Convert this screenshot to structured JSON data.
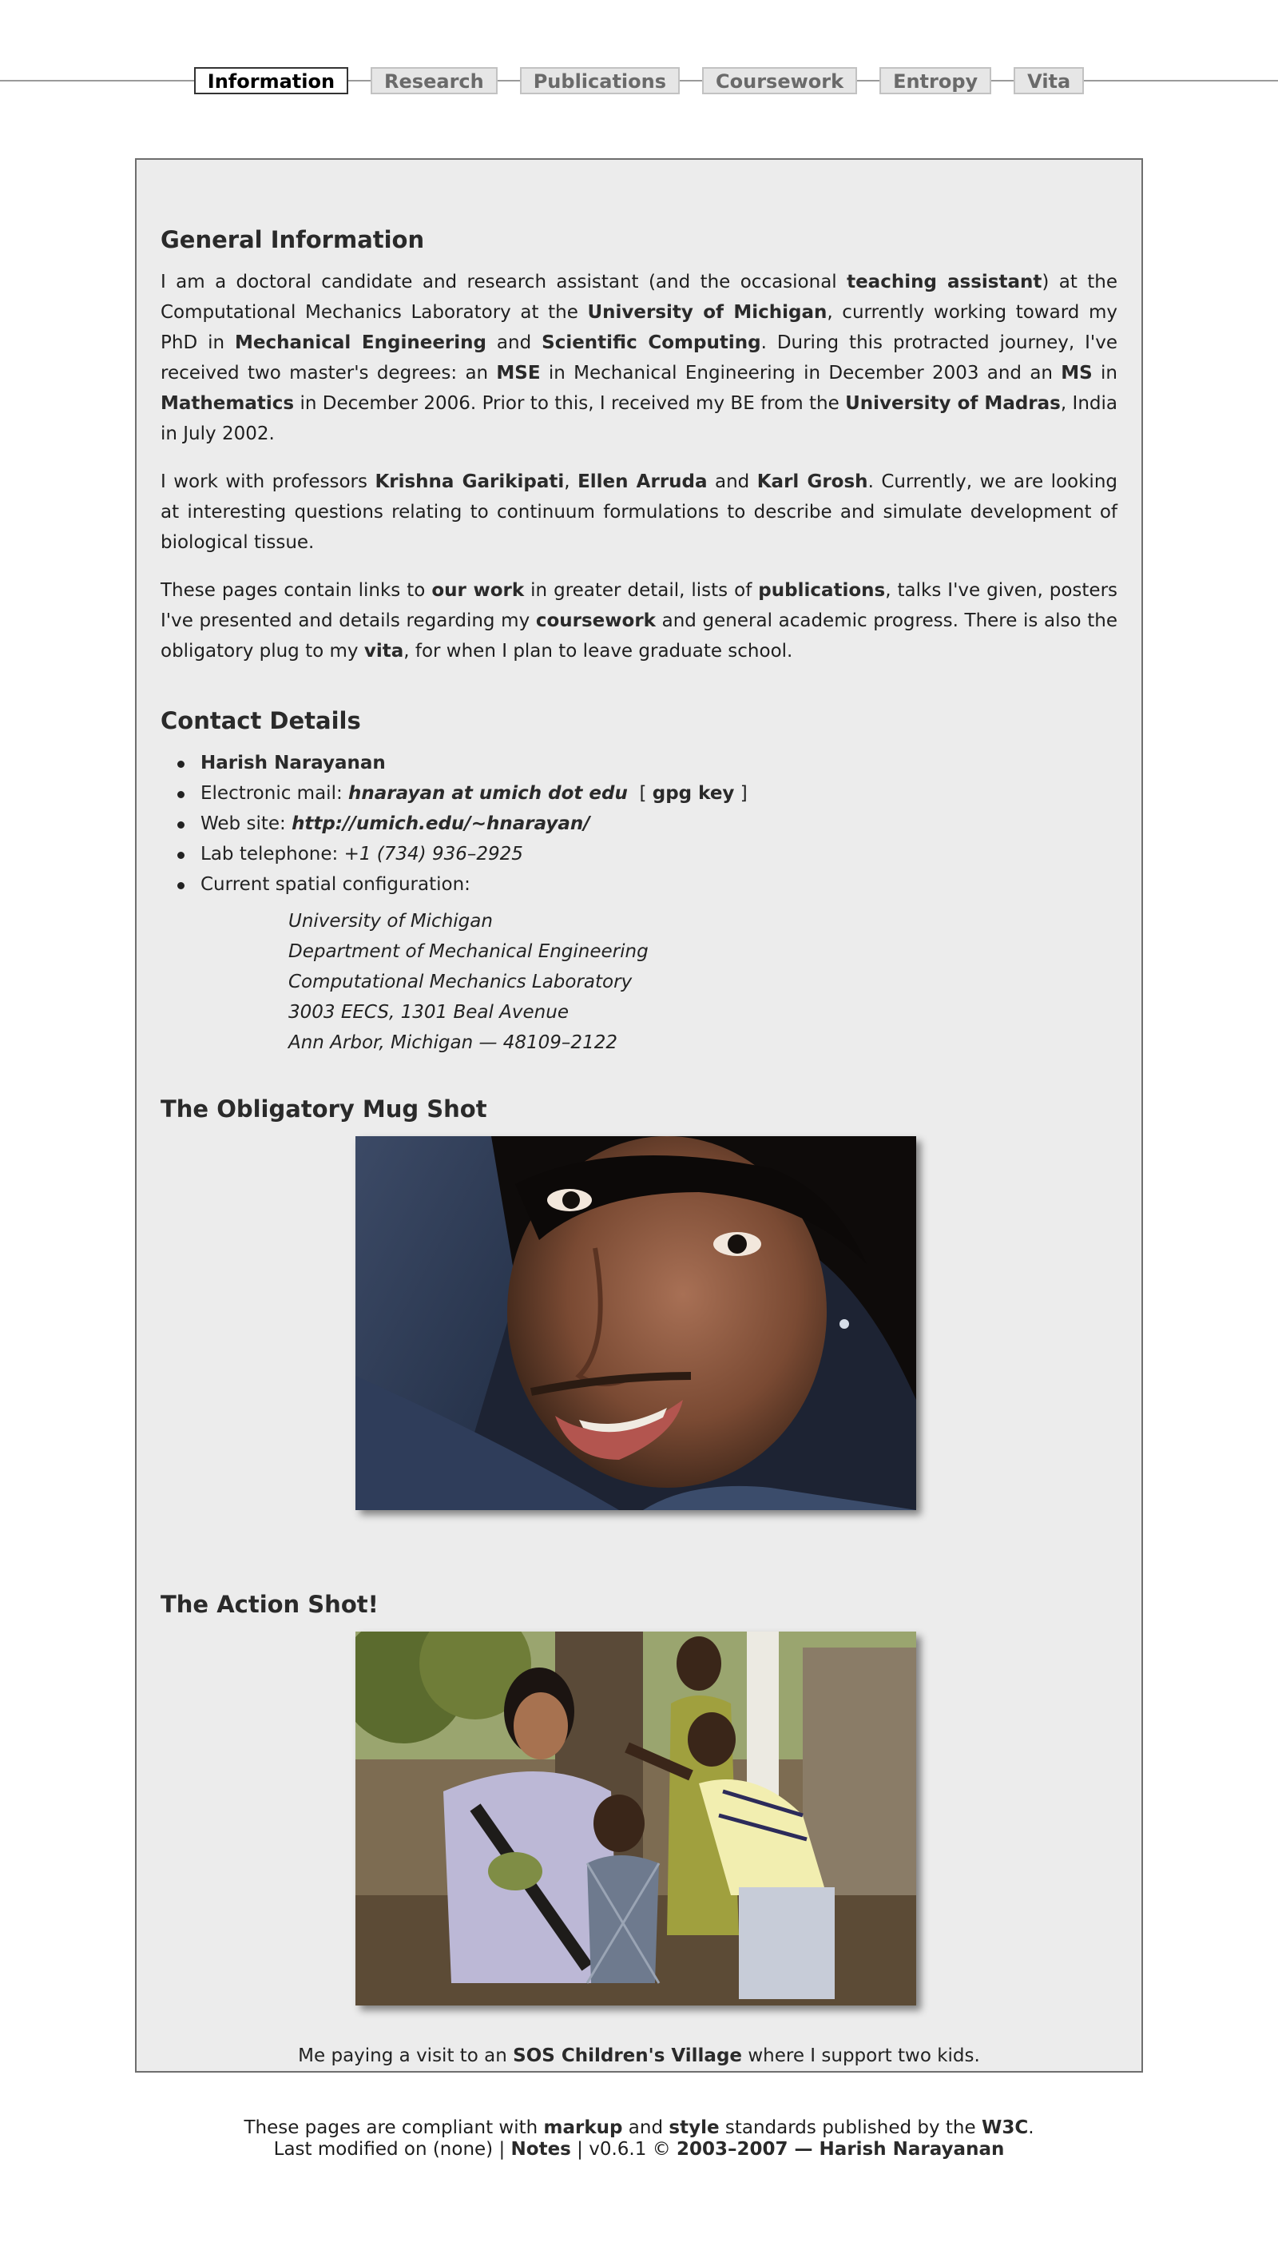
{
  "nav": {
    "items": [
      {
        "label": "Information",
        "active": true
      },
      {
        "label": "Research",
        "active": false
      },
      {
        "label": "Publications",
        "active": false
      },
      {
        "label": "Coursework",
        "active": false
      },
      {
        "label": "Entropy",
        "active": false
      },
      {
        "label": "Vita",
        "active": false
      }
    ]
  },
  "general": {
    "heading": "General Information",
    "p1": {
      "t1": "I am a doctoral candidate and research assistant (and the occasional ",
      "b1": "teaching assistant",
      "t2": ") at the Computational Mechanics Laboratory at the ",
      "b2": "University of Michigan",
      "t3": ", currently working toward my PhD in ",
      "b3": "Mechanical Engineering",
      "t4": " and ",
      "b4": "Scientific Computing",
      "t5": ". During this protracted journey, I've received two master's degrees: an ",
      "b5": "MSE",
      "t6": " in Mechanical Engineering in December 2003 and an ",
      "b6": "MS",
      "t7": " in ",
      "b7": "Mathematics",
      "t8": " in December 2006. Prior to this, I received my BE from the ",
      "b8": "University of Madras",
      "t9": ", India in July 2002."
    },
    "p2": {
      "t1": "I work with professors ",
      "b1": "Krishna Garikipati",
      "t2": ", ",
      "b2": "Ellen Arruda",
      "t3": " and ",
      "b3": "Karl Grosh",
      "t4": ". Currently, we are looking at interesting questions relating to continuum formulations to describe and simulate development of biological tissue."
    },
    "p3": {
      "t1": "These pages contain links to ",
      "b1": "our work",
      "t2": " in greater detail, lists of ",
      "b2": "publications",
      "t3": ", talks I've given, posters I've presented and details regarding my ",
      "b3": "coursework",
      "t4": " and general academic progress. There is also the obligatory plug to my ",
      "b4": "vita",
      "t5": ", for when I plan to leave graduate school."
    }
  },
  "contact": {
    "heading": "Contact Details",
    "name": "Harish Narayanan",
    "email_label": "Electronic mail: ",
    "email": "hnarayan at umich dot edu",
    "gpg_open": "[",
    "gpg": "gpg key",
    "gpg_close": "]",
    "web_label": "Web site: ",
    "web": "http://umich.edu/~hnarayan/",
    "phone_label": "Lab telephone: ",
    "phone": "+1 (734) 936–2925",
    "location_label": "Current spatial configuration:",
    "address": [
      "University of Michigan",
      "Department of Mechanical Engineering",
      "Computational Mechanics Laboratory",
      "3003 EECS, 1301 Beal Avenue",
      "Ann Arbor, Michigan — 48109–2122"
    ]
  },
  "mug": {
    "heading": "The Obligatory Mug Shot"
  },
  "action": {
    "heading": "The Action Shot!",
    "caption_t1": "Me paying a visit to an ",
    "caption_b1": "SOS Children's Village",
    "caption_t2": " where I support two kids."
  },
  "footer": {
    "l1_t1": "These pages are compliant with ",
    "l1_b1": "markup",
    "l1_t2": " and ",
    "l1_b2": "style",
    "l1_t3": " standards published by the ",
    "l1_b3": "W3C",
    "l1_t4": ".",
    "l2_t1": "Last modified on (none) | ",
    "l2_b1": "Notes",
    "l2_t2": " | v0.6.1 © ",
    "l2_b2": "2003–2007 — Harish Narayanan"
  },
  "colors": {
    "page_bg": "#ffffff",
    "panel_bg": "#ececec",
    "panel_border": "#6e6e6e",
    "tab_bg": "#e6e6e6",
    "tab_active_border": "#333333"
  }
}
